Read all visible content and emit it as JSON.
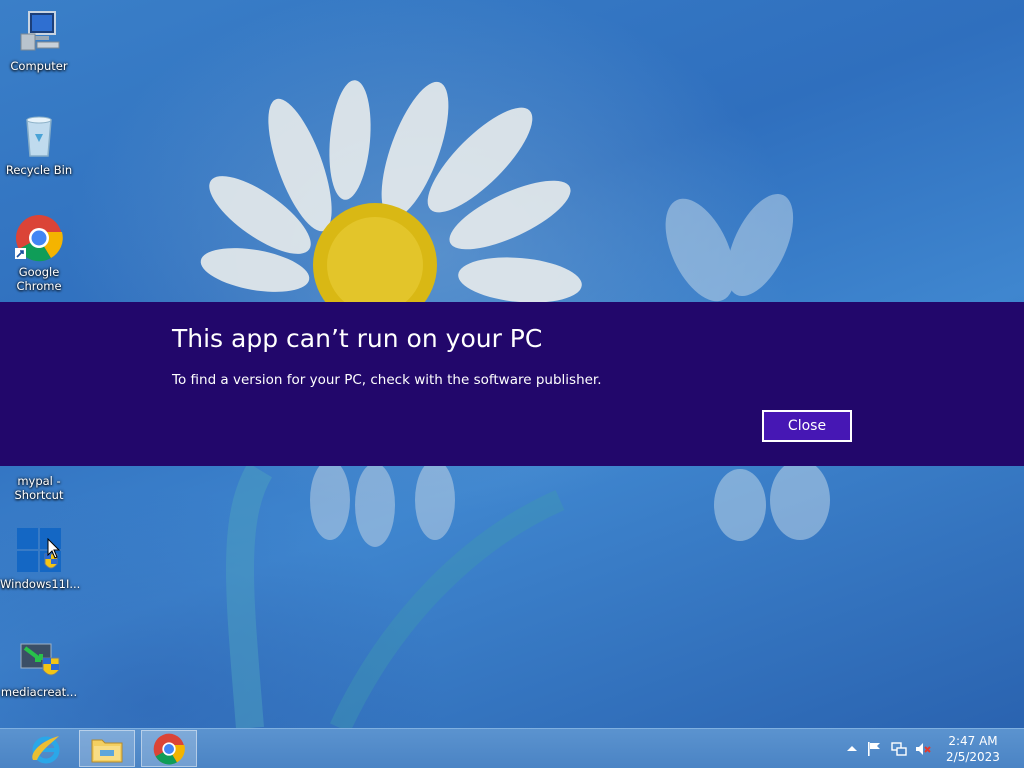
{
  "desktop": {
    "icons": [
      {
        "label": "Computer"
      },
      {
        "label": "Recycle Bin"
      },
      {
        "label": "Google Chrome"
      },
      {
        "label": "mypal - Shortcut"
      },
      {
        "label": "Windows11I..."
      },
      {
        "label": "mediacreat..."
      }
    ]
  },
  "dialog": {
    "title": "This app can’t run on your PC",
    "message": "To find a version for your PC, check with the software publisher.",
    "close_label": "Close",
    "background_color": "#22076b",
    "button_color": "#4617b4"
  },
  "taskbar": {
    "pinned": [
      {
        "name": "internet-explorer-icon"
      },
      {
        "name": "file-explorer-icon"
      },
      {
        "name": "chrome-icon"
      }
    ],
    "tray": {
      "icons": [
        "show-hidden-icons-arrow",
        "action-center-flag-icon",
        "network-icon",
        "volume-muted-icon"
      ],
      "time": "2:47 AM",
      "date": "2/5/2023"
    }
  }
}
